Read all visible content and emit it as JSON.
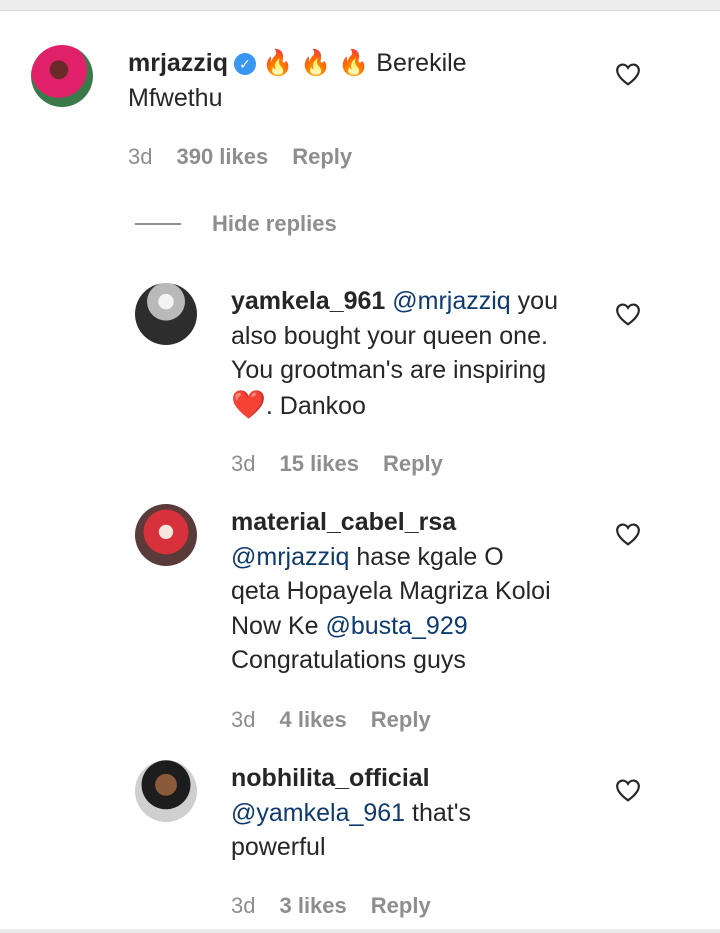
{
  "comments": [
    {
      "username": "mrjazziq",
      "verified": true,
      "emojis": "🔥 🔥 🔥",
      "text": "Berekile",
      "text_line2": "Mfwethu",
      "time": "3d",
      "likes": "390 likes",
      "reply_label": "Reply"
    },
    {
      "username": "yamkela_961",
      "mention": "@mrjazziq",
      "text_after_mention": " you",
      "line2": "also bought your queen one.",
      "line3": "You grootman's are inspiring",
      "heart": "❤️",
      "line4_after": ". Dankoo",
      "time": "3d",
      "likes": "15 likes",
      "reply_label": "Reply"
    },
    {
      "username": "material_cabel_rsa",
      "mention": "@mrjazziq",
      "text_after_mention": " hase kgale O",
      "line3": "qeta Hopayela Magriza Koloi",
      "line4_before": "Now Ke ",
      "mention2": "@busta_929",
      "line5": "Congratulations guys",
      "time": "3d",
      "likes": "4 likes",
      "reply_label": "Reply"
    },
    {
      "username": "nobhilita_official",
      "mention": "@yamkela_961",
      "text_after_mention": " that's",
      "line3": "powerful",
      "time": "3d",
      "likes": "3 likes",
      "reply_label": "Reply"
    }
  ],
  "hide_replies_label": "Hide replies",
  "icons": {
    "like": "heart-outline-icon",
    "verified": "verified-badge-icon"
  },
  "colors": {
    "mention": "#0f3a6e",
    "meta": "#8e8e8e",
    "verified": "#3897f0"
  }
}
